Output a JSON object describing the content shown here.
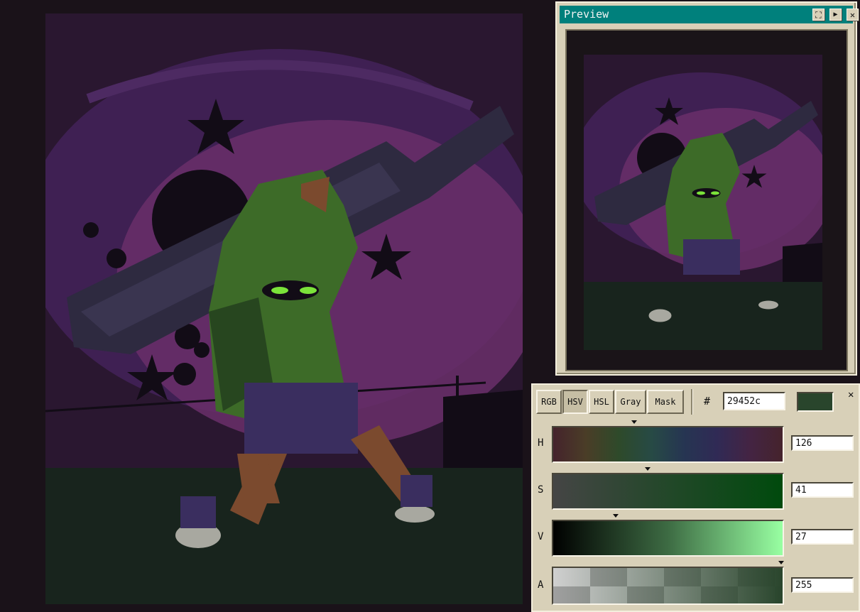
{
  "preview": {
    "title": "Preview",
    "buttons": [
      "⛶",
      "▶",
      "✕"
    ]
  },
  "color_panel": {
    "tabs": [
      {
        "label": "RGB",
        "active": false
      },
      {
        "label": "HSV",
        "active": true
      },
      {
        "label": "HSL",
        "active": false
      },
      {
        "label": "Gray",
        "active": false
      },
      {
        "label": "Mask",
        "active": false
      }
    ],
    "hash": "#",
    "hex_value": "29452c",
    "swatch_color": "#29452c",
    "close": "✕",
    "channels": [
      {
        "label": "H",
        "value": "126",
        "level": 0.35
      },
      {
        "label": "S",
        "value": "41",
        "level": 0.41
      },
      {
        "label": "V",
        "value": "27",
        "level": 0.27
      },
      {
        "label": "A",
        "value": "255",
        "level": 1.0
      }
    ]
  },
  "colors": {
    "sky_dark": "#2a1730",
    "sky_mid": "#3f2053",
    "moon": "#6a2f6a",
    "ground": "#18241d",
    "character_green": "#3d6b28",
    "character_dark": "#27461f",
    "skin": "#7b4a2e",
    "eyes": "#7be33a",
    "shorts": "#3a2e5f",
    "silhouette": "#120c16",
    "beam": "#2e2a40"
  }
}
